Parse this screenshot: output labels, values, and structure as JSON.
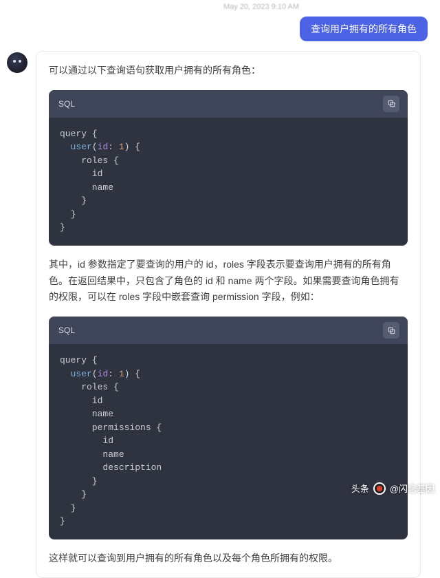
{
  "header": {
    "timestamp_faint": "May 20, 2023 9:10 AM"
  },
  "user_message": {
    "text": "查询用户拥有的所有角色"
  },
  "assistant": {
    "intro": "可以通过以下查询语句获取用户拥有的所有角色：",
    "code1": {
      "lang": "SQL",
      "lines": {
        "l1a": "query",
        "l1b": " {",
        "l2a": "  ",
        "l2b": "user",
        "l2c": "(",
        "l2d": "id",
        "l2e": ": ",
        "l2f": "1",
        "l2g": ") {",
        "l3a": "    roles {",
        "l4a": "      id",
        "l5a": "      name",
        "l6a": "    }",
        "l7a": "  }",
        "l8a": "}"
      }
    },
    "middle": "其中，id 参数指定了要查询的用户的 id，roles 字段表示要查询用户拥有的所有角色。在返回结果中，只包含了角色的 id 和 name 两个字段。如果需要查询角色拥有的权限，可以在 roles 字段中嵌套查询 permission 字段，例如：",
    "code2": {
      "lang": "SQL",
      "lines": {
        "l1a": "query",
        "l1b": " {",
        "l2a": "  ",
        "l2b": "user",
        "l2c": "(",
        "l2d": "id",
        "l2e": ": ",
        "l2f": "1",
        "l2g": ") {",
        "l3a": "    roles {",
        "l4a": "      id",
        "l5a": "      name",
        "l6a": "      permissions {",
        "l7a": "        id",
        "l8a": "        name",
        "l9a": "        description",
        "l10a": "      }",
        "l11a": "    }",
        "l12a": "  }",
        "l13a": "}"
      }
    },
    "outro": "这样就可以查询到用户拥有的所有角色以及每个角色所拥有的权限。"
  },
  "watermark": {
    "label1": "头条",
    "label2": "@闪念基因"
  }
}
